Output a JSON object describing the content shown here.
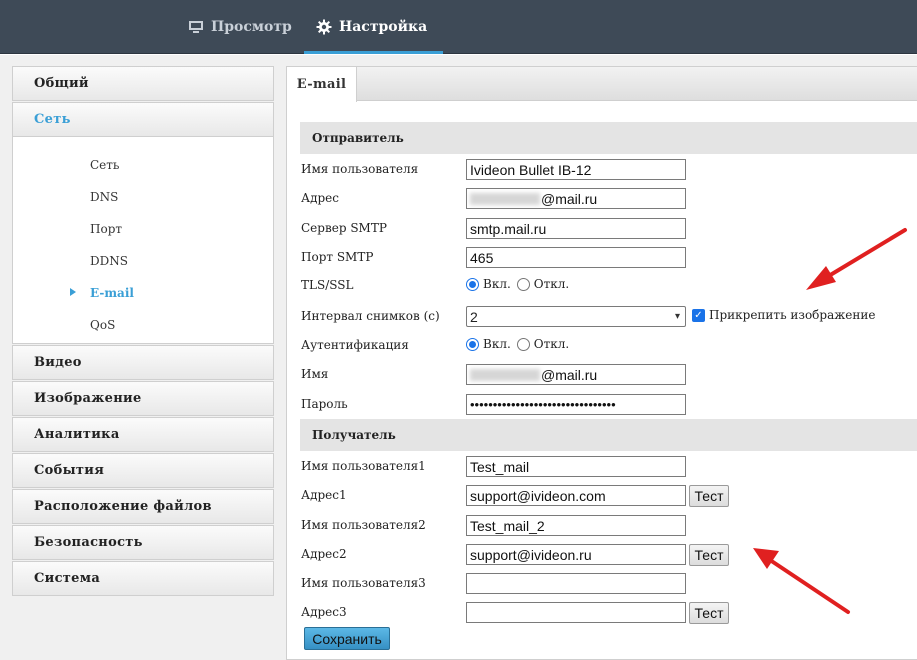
{
  "topbar": {
    "tabs": [
      {
        "label": "Просмотр",
        "icon": "monitor-icon"
      },
      {
        "label": "Настройка",
        "icon": "gear-icon"
      }
    ],
    "accent": "#3a9fd6"
  },
  "sidebar": {
    "items": [
      {
        "label": "Общий"
      },
      {
        "label": "Сеть"
      },
      {
        "label": "Видео"
      },
      {
        "label": "Изображение"
      },
      {
        "label": "Аналитика"
      },
      {
        "label": "События"
      },
      {
        "label": "Расположение файлов"
      },
      {
        "label": "Безопасность"
      },
      {
        "label": "Система"
      }
    ],
    "network_sub": [
      "Сеть",
      "DNS",
      "Порт",
      "DDNS",
      "E-mail",
      "QoS"
    ]
  },
  "main": {
    "tab": "E-mail",
    "sender": {
      "title": "Отправитель",
      "username_label": "Имя пользователя",
      "username_value": "Ivideon Bullet IB-12",
      "address_label": "Адрес",
      "address_value": "@mail.ru",
      "smtp_server_label": "Сервер SMTP",
      "smtp_server_value": "smtp.mail.ru",
      "smtp_port_label": "Порт SMTP",
      "smtp_port_value": "465",
      "tls_label": "TLS/SSL",
      "tls_on": "Вкл.",
      "tls_off": "Откл.",
      "interval_label": "Интервал снимков (с)",
      "interval_value": "2",
      "attach_label": "Прикрепить изображение",
      "auth_label": "Аутентификация",
      "auth_on": "Вкл.",
      "auth_off": "Откл.",
      "name_label": "Имя",
      "name_value": "@mail.ru",
      "password_label": "Пароль",
      "password_value": "••••••••••••••••••••••••••••••••"
    },
    "recipient": {
      "title": "Получатель",
      "rows": [
        {
          "user_label": "Имя пользователя1",
          "user_value": "Test_mail",
          "addr_label": "Адрес1",
          "addr_value": "support@ivideon.com"
        },
        {
          "user_label": "Имя пользователя2",
          "user_value": "Test_mail_2",
          "addr_label": "Адрес2",
          "addr_value": "support@ivideon.ru"
        },
        {
          "user_label": "Имя пользователя3",
          "user_value": "",
          "addr_label": "Адрес3",
          "addr_value": ""
        }
      ],
      "test_label": "Тест"
    },
    "save_label": "Сохранить"
  },
  "annotations": {
    "arrow_color": "#e02020"
  }
}
